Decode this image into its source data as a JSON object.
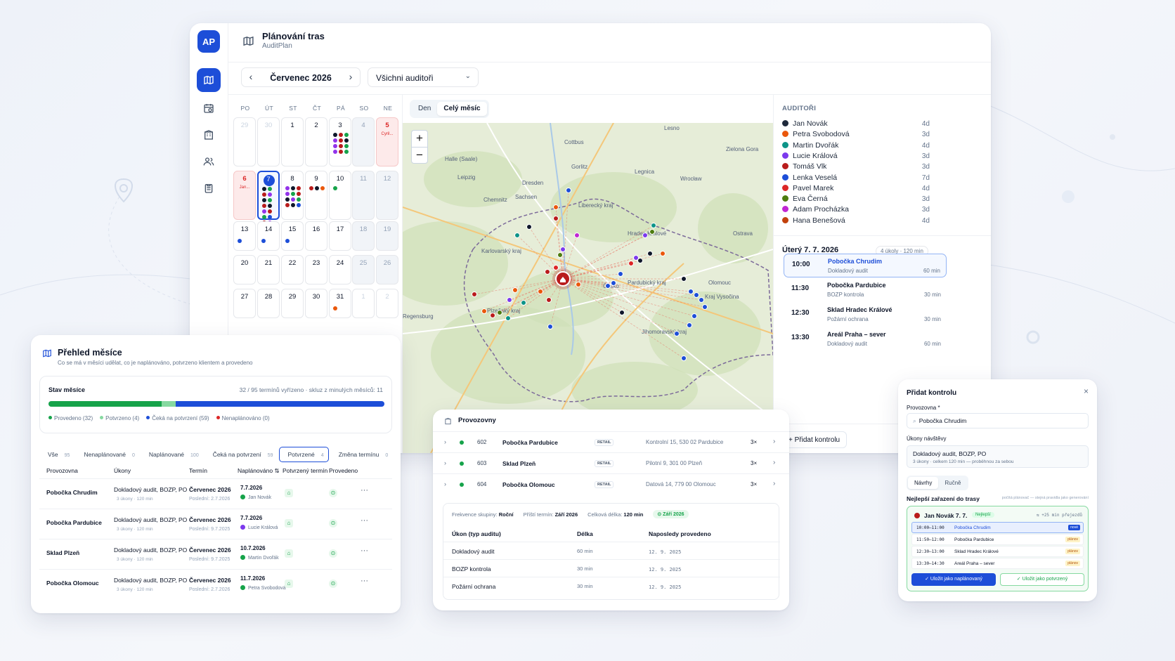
{
  "app": {
    "logo": "AP",
    "title": "Plánování tras",
    "subtitle": "AuditPlan",
    "nav_icons": [
      "map-icon",
      "calendar-icon",
      "building-icon",
      "users-icon",
      "clipboard-icon"
    ]
  },
  "toolbar": {
    "month": "Červenec 2026",
    "auditor_filter": "Všichni auditoři"
  },
  "calendar": {
    "weekdays": [
      "PO",
      "ÚT",
      "ST",
      "ČT",
      "PÁ",
      "SO",
      "NE"
    ],
    "days": [
      {
        "n": "29",
        "type": "out"
      },
      {
        "n": "30",
        "type": "out"
      },
      {
        "n": "1"
      },
      {
        "n": "2"
      },
      {
        "n": "3",
        "dots": [
          "#0f172a",
          "#b91c1c",
          "#16a34a",
          "#9333ea",
          "#b91c1c",
          "#0f172a",
          "#9333ea",
          "#b91c1c",
          "#16a34a",
          "#9333ea",
          "#b91c1c",
          "#16a34a"
        ]
      },
      {
        "n": "4",
        "type": "weekend"
      },
      {
        "n": "5",
        "type": "holiday",
        "label": "Cyril..."
      },
      {
        "n": "6",
        "type": "holiday",
        "label": "Jan..."
      },
      {
        "n": "7",
        "type": "sel",
        "dots": [
          "#0f172a",
          "#16a34a",
          "#b91c1c",
          "#9333ea",
          "#0f172a",
          "#16a34a",
          "#b91c1c",
          "#0f172a",
          "#9333ea",
          "#b91c1c",
          "#16a34a",
          "#1d4ed8",
          "#b91c1c",
          "#9333ea",
          "#0f172a"
        ]
      },
      {
        "n": "8",
        "dots": [
          "#9333ea",
          "#0f172a",
          "#b91c1c",
          "#9333ea",
          "#16a34a",
          "#b91c1c",
          "#0f172a",
          "#9333ea",
          "#16a34a",
          "#b91c1c",
          "#0f172a",
          "#1d4ed8"
        ]
      },
      {
        "n": "9",
        "dots": [
          "#b91c1c",
          "#0f172a",
          "#ea580c"
        ]
      },
      {
        "n": "10",
        "dots": [
          "#16a34a"
        ]
      },
      {
        "n": "11",
        "type": "weekend"
      },
      {
        "n": "12",
        "type": "weekend"
      },
      {
        "n": "13",
        "dots": [
          "#1d4ed8"
        ]
      },
      {
        "n": "14",
        "dots": [
          "#1d4ed8"
        ]
      },
      {
        "n": "15",
        "dots": [
          "#1d4ed8"
        ]
      },
      {
        "n": "16"
      },
      {
        "n": "17"
      },
      {
        "n": "18",
        "type": "weekend"
      },
      {
        "n": "19",
        "type": "weekend"
      },
      {
        "n": "20"
      },
      {
        "n": "21"
      },
      {
        "n": "22"
      },
      {
        "n": "23"
      },
      {
        "n": "24"
      },
      {
        "n": "25",
        "type": "weekend"
      },
      {
        "n": "26",
        "type": "weekend"
      },
      {
        "n": "27"
      },
      {
        "n": "28"
      },
      {
        "n": "29"
      },
      {
        "n": "30"
      },
      {
        "n": "31",
        "dots": [
          "#ea580c"
        ]
      },
      {
        "n": "1",
        "type": "out"
      },
      {
        "n": "2",
        "type": "out"
      }
    ]
  },
  "map": {
    "tabs": [
      "Den",
      "Celý měsíc"
    ],
    "active_tab": "Celý měsíc",
    "zoom_in": "+",
    "zoom_out": "−",
    "places": [
      "Halle (Saale)",
      "Leipzig",
      "Cottbus",
      "Dresden",
      "Wrocław",
      "Legnica",
      "Chemnitz",
      "Sachsen",
      "Liberecký kraj",
      "Hradec Králové",
      "Karlovarský kraj",
      "Plzeňský kraj",
      "Pardubický kraj",
      "Česko",
      "Kraj Vysočina",
      "Olomouc",
      "Ostrava",
      "Jihomoravský kraj",
      "Regensburg",
      "Lesno",
      "Gorlitz",
      "Zielona Gora"
    ]
  },
  "auditors": {
    "heading": "AUDITOŘI",
    "items": [
      {
        "name": "Jan Novák",
        "days": "4d",
        "color": "#1e293b"
      },
      {
        "name": "Petra Svobodová",
        "days": "3d",
        "color": "#ea580c"
      },
      {
        "name": "Martin Dvořák",
        "days": "4d",
        "color": "#0d9488"
      },
      {
        "name": "Lucie Králová",
        "days": "3d",
        "color": "#7c3aed"
      },
      {
        "name": "Tomáš Vlk",
        "days": "3d",
        "color": "#b91c1c"
      },
      {
        "name": "Lenka Veselá",
        "days": "7d",
        "color": "#1d4ed8"
      },
      {
        "name": "Pavel Marek",
        "days": "4d",
        "color": "#dc2626"
      },
      {
        "name": "Eva Černá",
        "days": "3d",
        "color": "#4d7c0f"
      },
      {
        "name": "Adam Procházka",
        "days": "3d",
        "color": "#c026d3"
      },
      {
        "name": "Hana Benešová",
        "days": "4d",
        "color": "#c2410c"
      }
    ]
  },
  "day_plan": {
    "title": "Úterý 7. 7. 2026",
    "meta": "4 úkoly · 120 min",
    "slots": [
      {
        "time": "10:00",
        "title": "Pobočka Chrudim",
        "sub": "Dokladový audit",
        "dur": "60 min",
        "active": true
      },
      {
        "time": "11:30",
        "title": "Pobočka Pardubice",
        "sub": "BOZP kontrola",
        "dur": "30 min"
      },
      {
        "time": "12:30",
        "title": "Sklad Hradec Králové",
        "sub": "Požární ochrana",
        "dur": "30 min"
      },
      {
        "time": "13:30",
        "title": "Areál Praha – sever",
        "sub": "Dokladový audit",
        "dur": "60 min"
      }
    ],
    "add_button": "+  Přidat kontrolu"
  },
  "overview": {
    "title": "Přehled měsíce",
    "subtitle": "Co se má v měsíci udělat, co je naplánováno, potvrzeno klientem a provedeno",
    "status_title": "Stav měsíce",
    "status_right": "32 / 95 termínů vyřízeno · skluz z minulých měsíců: 11",
    "progress": {
      "done": 32,
      "confirmed": 4,
      "waiting": 59,
      "unplanned": 0,
      "total": 95
    },
    "legend": [
      {
        "label": "Provedeno (32)",
        "color": "#16a34a"
      },
      {
        "label": "Potvrzeno (4)",
        "color": "#86d9a0"
      },
      {
        "label": "Čeká na potvrzení (59)",
        "color": "#1d4ed8"
      },
      {
        "label": "Nenaplánováno (0)",
        "color": "#dc2626"
      }
    ],
    "filters": [
      {
        "label": "Vše",
        "count": "95"
      },
      {
        "label": "Nenaplánované",
        "count": "0"
      },
      {
        "label": "Naplánované",
        "count": "100"
      },
      {
        "label": "Čeká na potvrzení",
        "count": "59"
      },
      {
        "label": "Potvrzené",
        "count": "4",
        "active": true
      },
      {
        "label": "Změna termínu",
        "count": "0"
      }
    ],
    "columns": [
      "Provozovna",
      "Úkony",
      "Termín",
      "Naplánováno ⇅",
      "Potvrzený termín",
      "Provedeno"
    ],
    "rows": [
      {
        "place": "Pobočka Chrudim",
        "tasks": "Dokladový audit, BOZP, PO",
        "tasks_sub": "3 úkony · 120 min",
        "term": "Červenec 2026",
        "term_sub": "Poslední: 2.7.2026",
        "planned": "7.7.2026",
        "auditor": "Jan Novák",
        "color": "#16a34a"
      },
      {
        "place": "Pobočka Pardubice",
        "tasks": "Dokladový audit, BOZP, PO",
        "tasks_sub": "3 úkony · 120 min",
        "term": "Červenec 2026",
        "term_sub": "Poslední: 9.7.2025",
        "planned": "7.7.2026",
        "auditor": "Lucie Králová",
        "color": "#7c3aed"
      },
      {
        "place": "Sklad Plzeň",
        "tasks": "Dokladový audit, BOZP, PO",
        "tasks_sub": "3 úkony · 120 min",
        "term": "Červenec 2026",
        "term_sub": "Poslední: 9.7.2025",
        "planned": "10.7.2026",
        "auditor": "Martin Dvořák",
        "color": "#16a34a"
      },
      {
        "place": "Pobočka Olomouc",
        "tasks": "Dokladový audit, BOZP, PO",
        "tasks_sub": "3 úkony · 120 min",
        "term": "Červenec 2026",
        "term_sub": "Poslední: 2.7.2026",
        "planned": "11.7.2026",
        "auditor": "Petra Svobodová",
        "color": "#16a34a"
      }
    ]
  },
  "provozovny": {
    "title": "Provozovny",
    "rows": [
      {
        "id": "602",
        "name": "Pobočka Pardubice",
        "tag": "RETAIL",
        "address": "Kontrolní 15, 530 02 Pardubice",
        "count": "3×"
      },
      {
        "id": "603",
        "name": "Sklad Plzeň",
        "tag": "RETAIL",
        "address": "Pilotní 9, 301 00 Plzeň",
        "count": "3×"
      },
      {
        "id": "604",
        "name": "Pobočka Olomouc",
        "tag": "RETAIL",
        "address": "Datová 14, 779 00 Olomouc",
        "count": "3×"
      }
    ],
    "detail": {
      "freq_label": "Frekvence skupiny:",
      "freq": "Roční",
      "next_label": "Příští termín:",
      "next": "Září 2026",
      "len_label": "Celková délka:",
      "len": "120 min",
      "pill": "Září 2026",
      "columns": [
        "Úkon (typ auditu)",
        "Délka",
        "Naposledy provedeno"
      ],
      "rows": [
        {
          "task": "Dokladový audit",
          "len": "60 min",
          "last": "12. 9. 2025"
        },
        {
          "task": "BOZP kontrola",
          "len": "30 min",
          "last": "12. 9. 2025"
        },
        {
          "task": "Požární ochrana",
          "len": "30 min",
          "last": "12. 9. 2025"
        }
      ]
    }
  },
  "add_form": {
    "title": "Přidat kontrolu",
    "close": "×",
    "place_label": "Provozovna *",
    "place_value": "Pobočka Chrudim",
    "tasks_label": "Úkony návštěvy",
    "tasks_value": "Dokladový audit, BOZP, PO",
    "tasks_sub": "3 úkony · celkem 120 min — proběhnou za sebou",
    "tabs": [
      "Návrhy",
      "Ručně"
    ],
    "best_label": "Nejlepší zařazení do trasy",
    "best_note": "počítá plánovač — stejná pravidla jako generování",
    "route": {
      "auditor": "Jan Novák  7. 7.",
      "badge": "Nejlepší",
      "extra": "+25 min přejezdů",
      "rows": [
        {
          "time": "10:00–11:00",
          "name": "Pobočka Chrudim",
          "status": "nové",
          "active": true
        },
        {
          "time": "11:50–12:00",
          "name": "Pobočka Pardubice",
          "status": "plánov"
        },
        {
          "time": "12:30–13:00",
          "name": "Sklad Hradec Králové",
          "status": "plánov"
        },
        {
          "time": "13:30–14:30",
          "name": "Areál Praha – sever",
          "status": "plánov"
        }
      ]
    },
    "save_planned": "✓ Uložit jako naplánovaný",
    "save_confirmed": "✓ Uložit jako potvrzený"
  }
}
